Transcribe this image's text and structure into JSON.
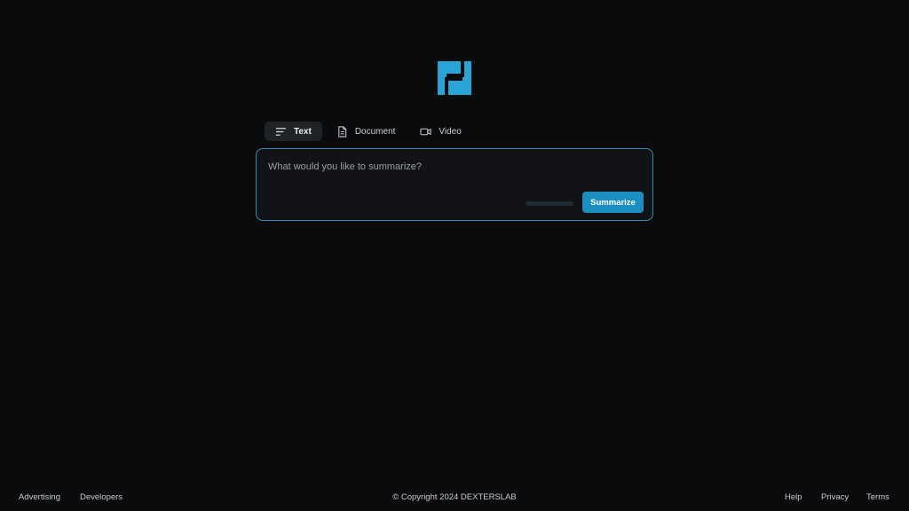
{
  "brand": {
    "logo_icon": "dexterslab-logo-icon",
    "logo_color": "#2aa3d6"
  },
  "tabs": [
    {
      "label": "Text",
      "icon": "text-lines-icon",
      "active": true
    },
    {
      "label": "Document",
      "icon": "document-icon",
      "active": false
    },
    {
      "label": "Video",
      "icon": "video-camera-icon",
      "active": false
    }
  ],
  "input": {
    "placeholder": "What would you like to summarize?",
    "value": "",
    "char_progress": 0.0,
    "submit_label": "Summarize",
    "accent_color": "#1a8fc0"
  },
  "footer": {
    "left_links": [
      "Advertising",
      "Developers"
    ],
    "copyright": "© Copyright 2024 DEXTERSLAB",
    "right_links": [
      "Help",
      "Privacy",
      "Terms"
    ]
  }
}
